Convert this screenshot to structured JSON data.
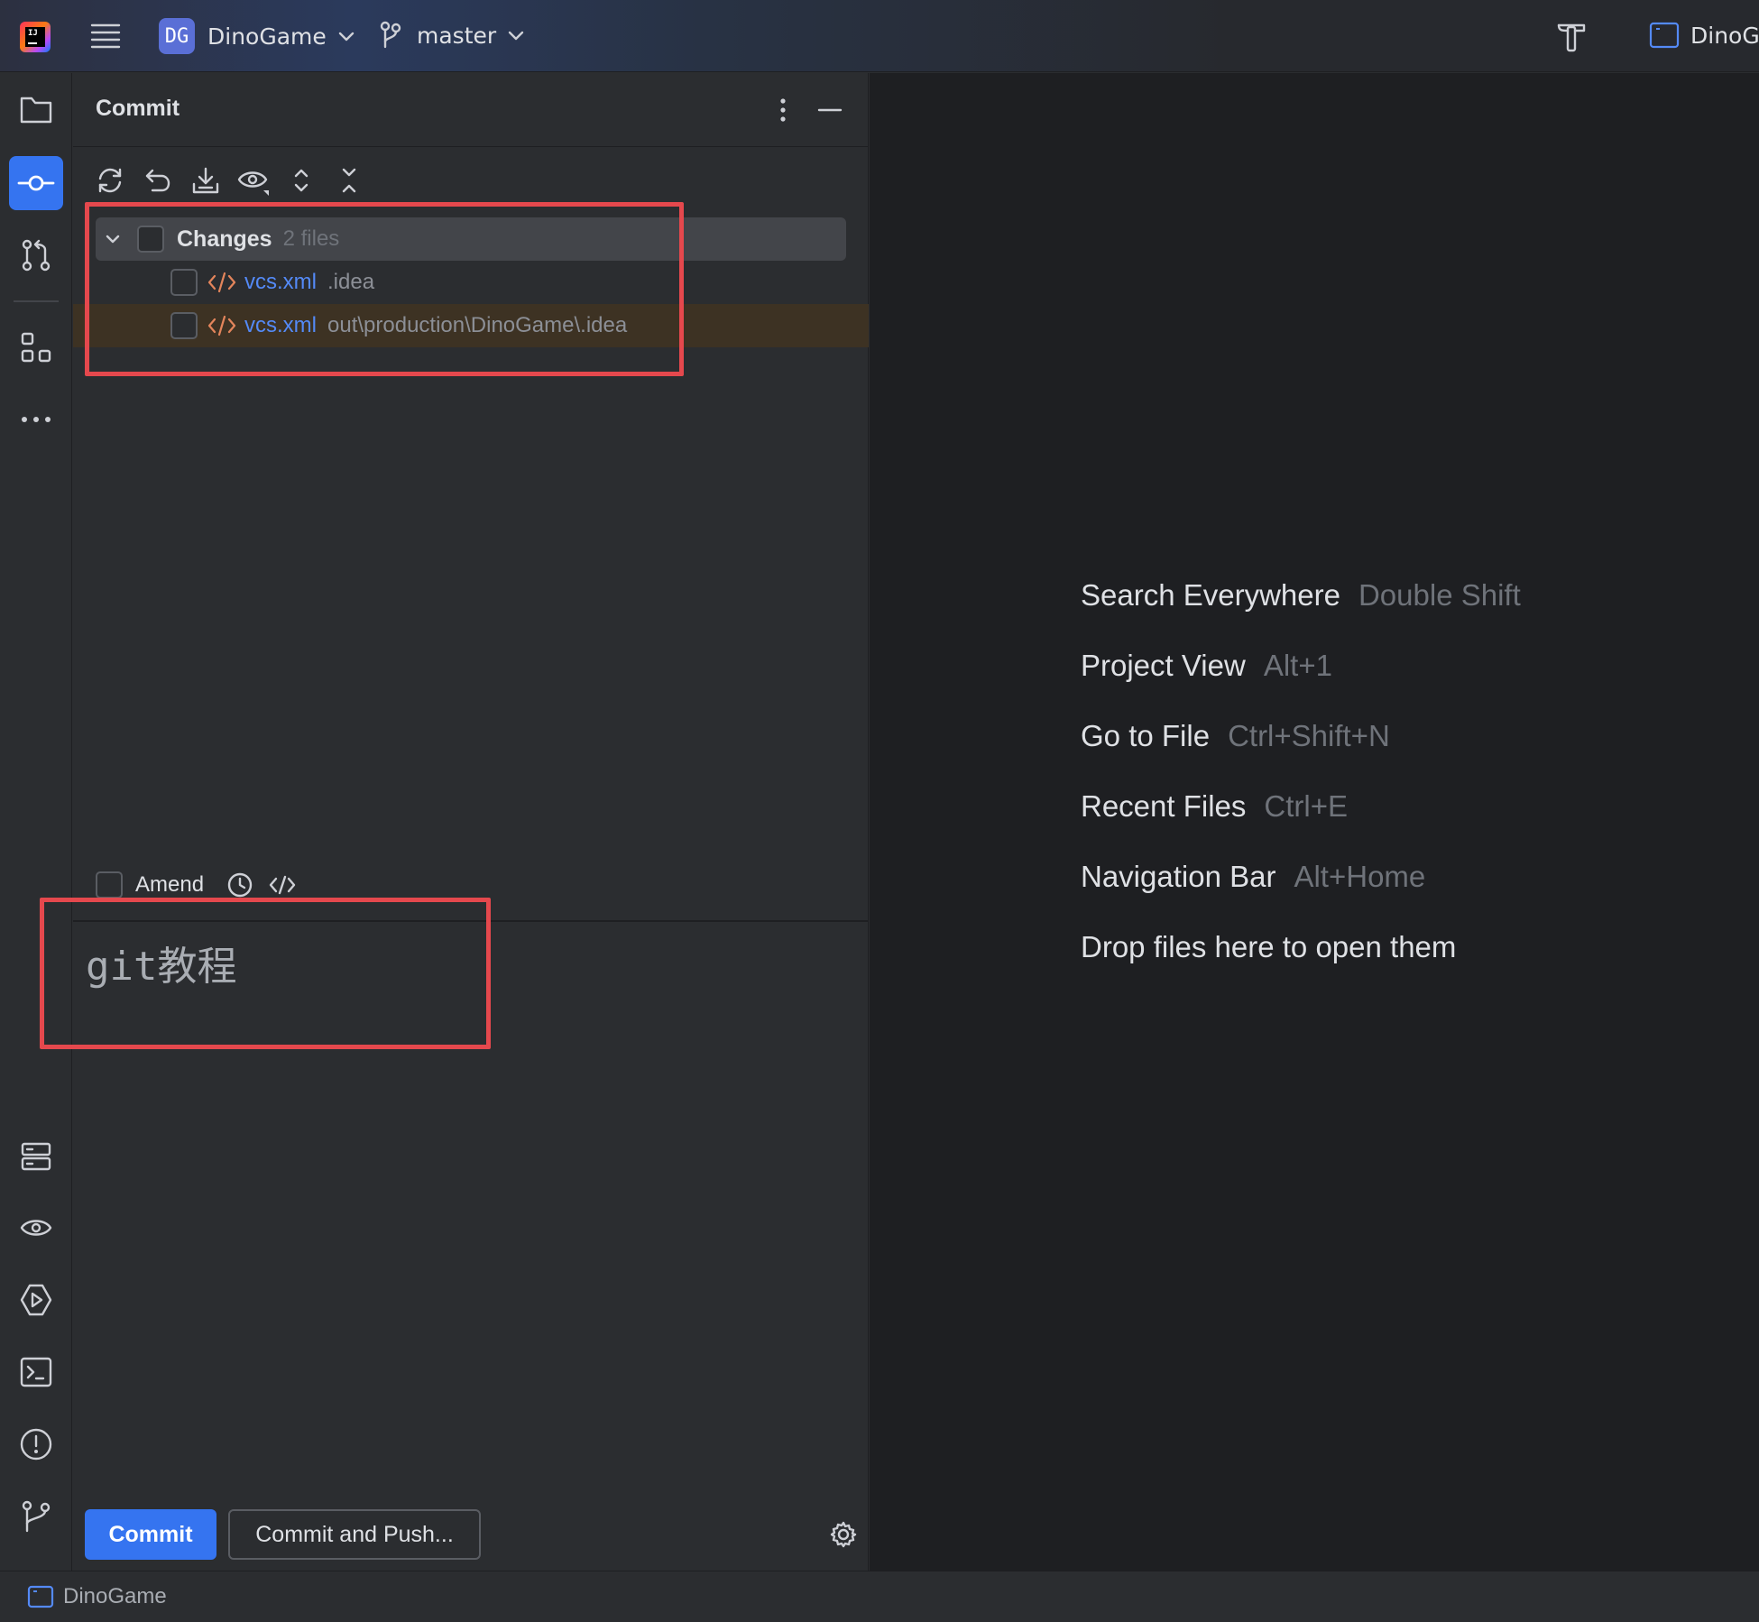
{
  "titlebar": {
    "project_badge": "DG",
    "project_name": "DinoGame",
    "branch": "master",
    "run_config": "DinoGa"
  },
  "left_stripe": {
    "items": [
      {
        "icon": "folder-icon"
      },
      {
        "icon": "commit-icon",
        "active": true
      },
      {
        "icon": "pull-requests-icon"
      },
      {
        "icon": "structure-icon"
      },
      {
        "icon": "more-icon"
      },
      {
        "icon": "services-icon"
      },
      {
        "icon": "eye-icon"
      },
      {
        "icon": "run-icon"
      },
      {
        "icon": "terminal-icon"
      },
      {
        "icon": "problems-icon"
      },
      {
        "icon": "git-icon"
      }
    ]
  },
  "commit_panel": {
    "title": "Commit",
    "changes": {
      "label": "Changes",
      "count": "2 files",
      "files": [
        {
          "name": "vcs.xml",
          "path": ".idea"
        },
        {
          "name": "vcs.xml",
          "path": "out\\production\\DinoGame\\.idea"
        }
      ]
    },
    "amend_label": "Amend",
    "message": "git教程",
    "commit_button": "Commit",
    "commit_push_button": "Commit and Push..."
  },
  "editor": {
    "hints": [
      {
        "label": "Search Everywhere",
        "key": "Double Shift"
      },
      {
        "label": "Project View",
        "key": "Alt+1"
      },
      {
        "label": "Go to File",
        "key": "Ctrl+Shift+N"
      },
      {
        "label": "Recent Files",
        "key": "Ctrl+E"
      },
      {
        "label": "Navigation Bar",
        "key": "Alt+Home"
      },
      {
        "label": "Drop files here to open them",
        "key": ""
      }
    ]
  },
  "statusbar": {
    "project": "DinoGame"
  },
  "colors": {
    "accent": "#3574f0",
    "annotation_red": "#e5484d",
    "file_blue": "#548af7",
    "xml_orange": "#e3855b"
  }
}
